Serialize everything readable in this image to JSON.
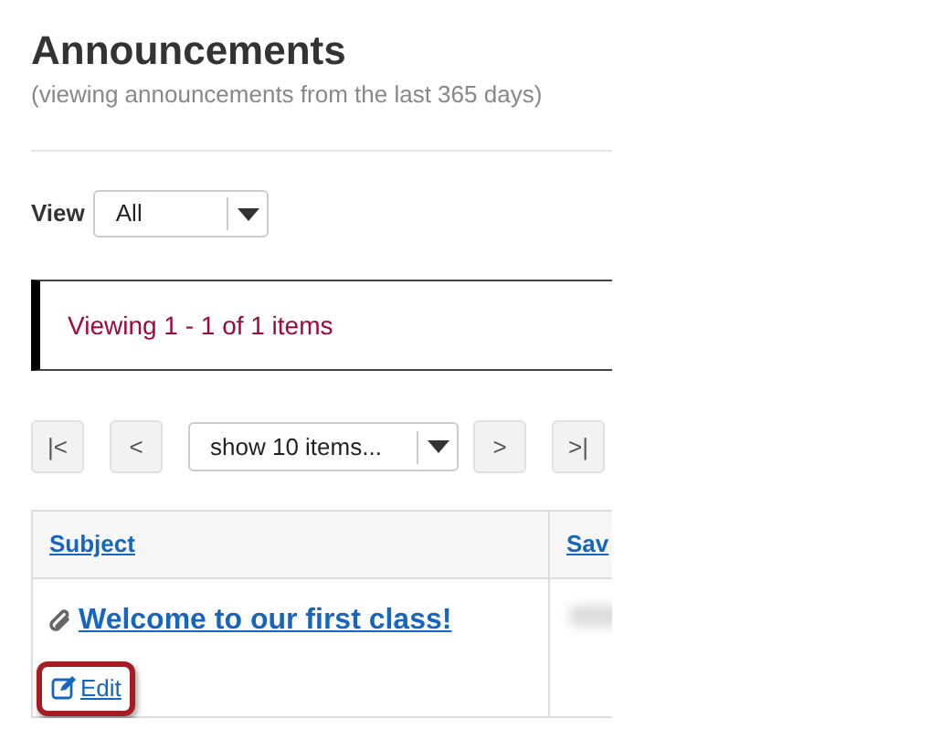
{
  "title": "Announcements",
  "subtitle": "(viewing announcements from the last 365 days)",
  "view": {
    "label": "View",
    "value": "All"
  },
  "alert": "Viewing 1 - 1 of 1 items",
  "pager": {
    "first": "|<",
    "prev": "<",
    "page_size": "show 10 items...",
    "next": ">",
    "last": ">|"
  },
  "table": {
    "columns": [
      "Subject",
      "Sav"
    ],
    "rows": [
      {
        "subject": "Welcome to our first class!",
        "attachment": true,
        "action": "Edit",
        "highlighted": true
      }
    ]
  }
}
